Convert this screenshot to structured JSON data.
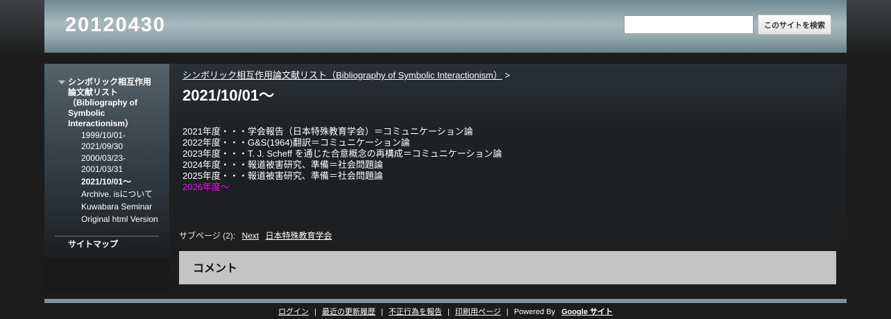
{
  "header": {
    "site_title": "20120430",
    "search_placeholder": "",
    "search_button": "このサイトを検索"
  },
  "sidebar": {
    "top_item": "シンボリック相互作用論文献リスト（Bibliography of Symbolic Interactionism）",
    "children": [
      {
        "label": "1999/10/01-2021/09/30",
        "current": false
      },
      {
        "label": "2000/03/23-2001/03/31",
        "current": false
      },
      {
        "label": "2021/10/01～",
        "current": true
      },
      {
        "label": "Archive. isについて",
        "current": false
      },
      {
        "label": "Kuwabara Seminar",
        "current": false
      },
      {
        "label": "Original html Version",
        "current": false
      }
    ],
    "sitemap": "サイトマップ"
  },
  "main": {
    "breadcrumb_link": "シンボリック相互作用論文献リスト（Bibliography of Symbolic Interactionism）",
    "breadcrumb_sep": ">",
    "page_title": "2021/10/01～",
    "lines": [
      "2021年度・・・学会報告（日本特殊教育学会）＝コミュニケーション論",
      "2022年度・・・G&S(1964)翻訳＝コミュニケーション論",
      "2023年度・・・T. J. Scheff を通じた合意概念の再構成＝コミュニケーション論",
      "2024年度・・・報道被害研究、準備＝社会問題論",
      "2025年度・・・報道被害研究、準備＝社会問題論"
    ],
    "highlight_line": "2026年度～",
    "highlight_color": "#ff00ff",
    "subpages_label": "サブページ (2):",
    "subpages": [
      "Next",
      "日本特殊教育学会"
    ],
    "comments_title": "コメント"
  },
  "footer": {
    "login": "ログイン",
    "recent": "最近の更新履歴",
    "report": "不正行為を報告",
    "print": "印刷用ページ",
    "powered_by": "Powered By",
    "google_sites": "Google サイト",
    "separator": "|"
  }
}
